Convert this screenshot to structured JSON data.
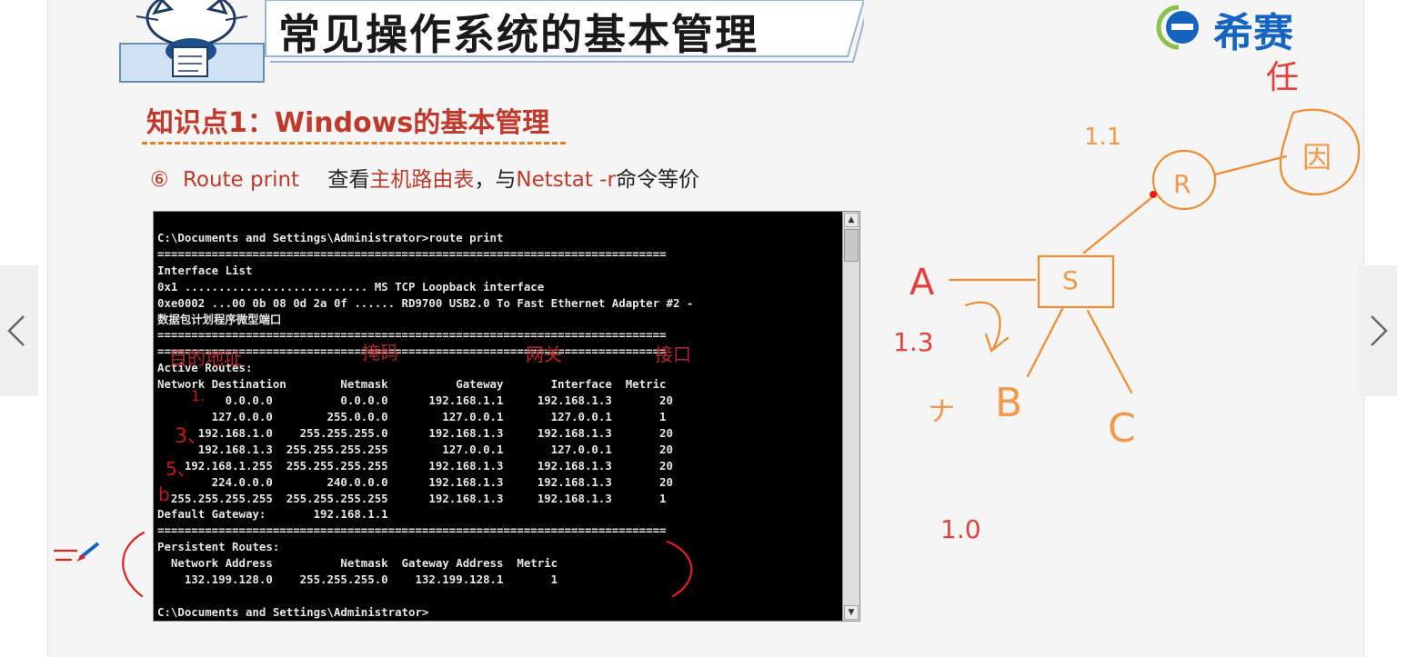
{
  "header": {
    "title": "常见操作系统的基本管理",
    "logo_text": "希赛"
  },
  "section": {
    "kp_title": "知识点1：Windows的基本管理"
  },
  "subline": {
    "num": "⑥",
    "cmd": "Route print",
    "text1": "查看",
    "text2": "主机路由表",
    "text3": "，与",
    "text4": "Netstat -r",
    "text5": "命令等价"
  },
  "terminal": {
    "prompt_line": "C:\\Documents and Settings\\Administrator>route print",
    "sep1": "===========================================================================",
    "interface_list_label": "Interface List",
    "iface1": "0x1 ........................... MS TCP Loopback interface",
    "iface2": "0xe0002 ...00 0b 08 0d 2a 0f ...... RD9700 USB2.0 To Fast Ethernet Adapter #2 -",
    "iface2_cont": "数据包计划程序微型端口",
    "sep2": "===========================================================================",
    "sep3": "===========================================================================",
    "active_routes_label": "Active Routes:",
    "route_header": "Network Destination        Netmask          Gateway       Interface  Metric",
    "routes": [
      "          0.0.0.0          0.0.0.0      192.168.1.1     192.168.1.3       20",
      "        127.0.0.0        255.0.0.0        127.0.0.1       127.0.0.1       1",
      "      192.168.1.0    255.255.255.0      192.168.1.3     192.168.1.3       20",
      "      192.168.1.3  255.255.255.255        127.0.0.1       127.0.0.1       20",
      "    192.168.1.255  255.255.255.255      192.168.1.3     192.168.1.3       20",
      "        224.0.0.0        240.0.0.0      192.168.1.3     192.168.1.3       20",
      "  255.255.255.255  255.255.255.255      192.168.1.3     192.168.1.3       1"
    ],
    "default_gateway": "Default Gateway:       192.168.1.1",
    "sep4": "===========================================================================",
    "persistent_label": "Persistent Routes:",
    "persistent_header": "  Network Address          Netmask  Gateway Address  Metric",
    "persistent_row": "    132.199.128.0    255.255.255.0    132.199.128.1       1",
    "end_prompt": "C:\\Documents and Settings\\Administrator>"
  },
  "overlay_labels": {
    "dest": "目的地址",
    "mask": "掩码",
    "gateway": "网关",
    "iface": "接口"
  },
  "handwritten": {
    "ren": "任",
    "n11": "1.1",
    "R": "R",
    "yin": "因",
    "S": "S",
    "A": "A",
    "n13": "1.3",
    "B": "B",
    "C": "C",
    "n10": "1.0",
    "j": "ナ",
    "r1": "1.",
    "r3": "3、",
    "r5": "5、",
    "r6": "b"
  },
  "colors": {
    "accent_red": "#c0392b",
    "annot_orange": "#f28a2e",
    "annot_red": "#e0201b",
    "brand_blue": "#1565c0"
  }
}
